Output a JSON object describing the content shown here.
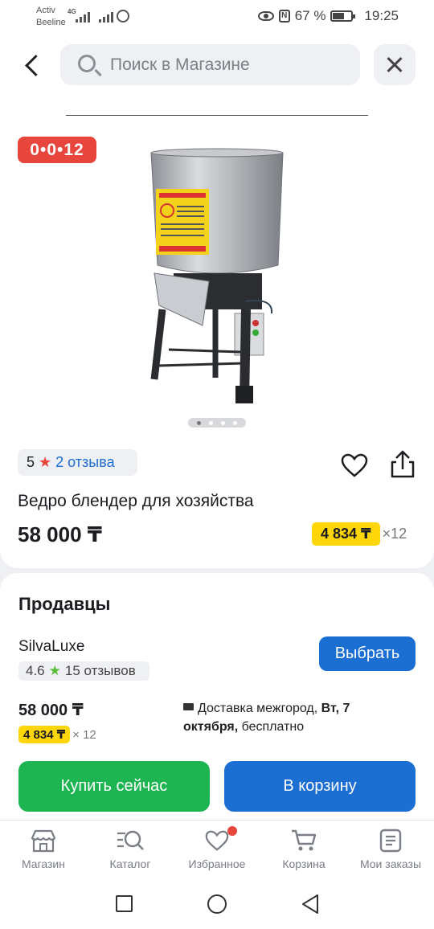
{
  "status_bar": {
    "carrier_1": "Activ",
    "carrier_2": "Beeline",
    "net": "4G",
    "battery": "67 %",
    "time": "19:25"
  },
  "search": {
    "placeholder": "Поиск в Магазине"
  },
  "product": {
    "timer": "0•0•12",
    "rating": "5",
    "reviews": "2 отзыва",
    "title": "Ведро блендер для хозяйства",
    "price": "58 000 ₸",
    "installment": "4 834 ₸",
    "installment_multiplier": "×12",
    "gallery_pages": 4,
    "gallery_active": 1
  },
  "sellers": {
    "title": "Продавцы",
    "seller_name": "SilvaLuxe",
    "seller_rating": "4.6",
    "seller_reviews": "15 отзывов",
    "choose_button": "Выбрать",
    "price": "58 000 ₸",
    "installment": "4 834 ₸",
    "installment_multiplier": "× 12",
    "delivery_prefix": "Доставка межгород, ",
    "delivery_day": "Вт, 7 октября,",
    "delivery_suffix": " бесплатно",
    "buy_now": "Купить сейчас",
    "add_to_cart": "В корзину"
  },
  "tabs": [
    {
      "label": "Магазин",
      "icon": "store-icon"
    },
    {
      "label": "Каталог",
      "icon": "catalog-search-icon"
    },
    {
      "label": "Избранное",
      "icon": "heart-icon"
    },
    {
      "label": "Корзина",
      "icon": "cart-icon"
    },
    {
      "label": "Мои заказы",
      "icon": "orders-icon"
    }
  ],
  "colors": {
    "accent_blue": "#1b6ed2",
    "buy_green": "#1db452",
    "timer_red": "#e8453c",
    "installment_yellow": "#ffd60a"
  }
}
